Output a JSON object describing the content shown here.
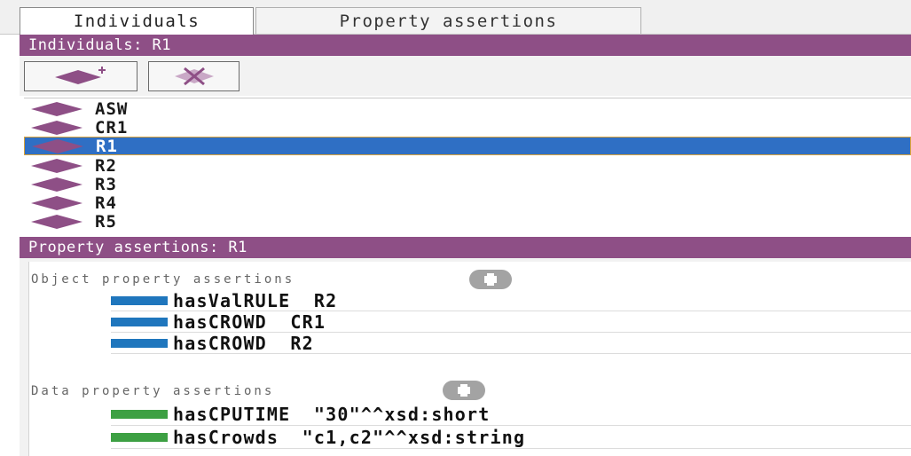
{
  "tabs": {
    "individuals": "Individuals",
    "property_assertions": "Property assertions"
  },
  "individuals_panel": {
    "title": "Individuals: R1",
    "items": [
      {
        "label": "ASW",
        "selected": false
      },
      {
        "label": "CR1",
        "selected": false
      },
      {
        "label": "R1",
        "selected": true
      },
      {
        "label": "R2",
        "selected": false
      },
      {
        "label": "R3",
        "selected": false
      },
      {
        "label": "R4",
        "selected": false
      },
      {
        "label": "R5",
        "selected": false
      }
    ]
  },
  "assertions_panel": {
    "title": "Property assertions: R1",
    "object_header": "Object property assertions",
    "object_rows": [
      {
        "property": "hasValRULE",
        "value": "R2"
      },
      {
        "property": "hasCROWD",
        "value": "CR1"
      },
      {
        "property": "hasCROWD",
        "value": "R2"
      }
    ],
    "data_header": "Data property assertions",
    "data_rows": [
      {
        "property": "hasCPUTIME",
        "value": "\"30\"^^xsd:short"
      },
      {
        "property": "hasCrowds",
        "value": "\"c1,c2\"^^xsd:string"
      }
    ]
  },
  "colors": {
    "panel_header": "#8e4f86",
    "individual_icon": "#8e4f86",
    "selection": "#2f6fc4",
    "object_property": "#1f76bd",
    "data_property": "#3da043"
  },
  "icons": {
    "add_individual": "diamond-plus-icon",
    "delete_individual": "delete-diamond-icon",
    "add_assertion": "plus-circle-icon"
  }
}
